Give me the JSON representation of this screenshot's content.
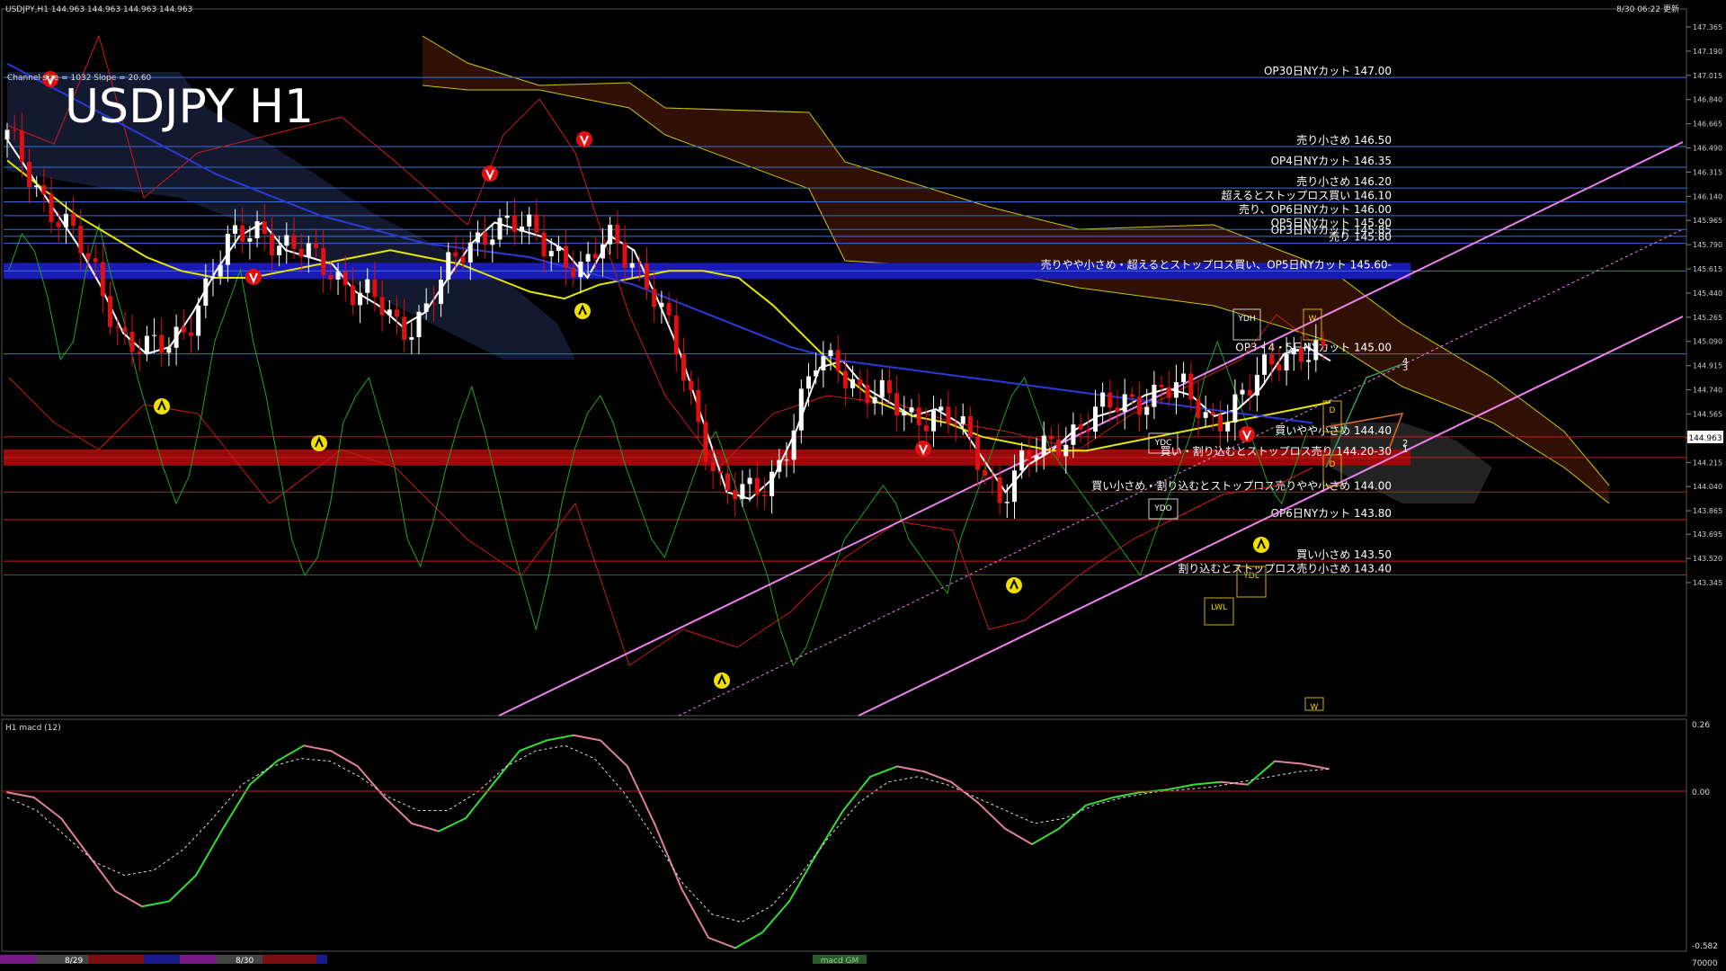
{
  "header": {
    "symbol_line": "USDJPY,H1  144.963 144.963 144.963 144.963",
    "datetime": "8/30 06:22 更新",
    "channel_info": "Channel size = 1032 Slope = 20.60",
    "big_title": "USDJPY H1"
  },
  "sub": {
    "title": "H1  macd (12)",
    "scale": [
      "0.26",
      "0.00",
      "-0.582"
    ],
    "bottom_value": "70000",
    "tab_label": "macd GM"
  },
  "dates": [
    "8/29",
    "8/30"
  ],
  "price_scale": [
    "147.365",
    "147.190",
    "147.015",
    "146.840",
    "146.665",
    "146.490",
    "146.315",
    "146.140",
    "145.965",
    "145.790",
    "145.615",
    "145.440",
    "145.265",
    "145.090",
    "144.915",
    "144.740",
    "144.565",
    "144.390",
    "144.215",
    "144.040",
    "143.865",
    "143.695",
    "143.520",
    "143.345"
  ],
  "current_price": "144.963",
  "colors": {
    "background": "#000000",
    "level_blue": "#3a6fd8",
    "level_red": "#cc1a1a",
    "blue_band": "#1a1ab4",
    "red_band": "#9b0a0a",
    "channel": "#ee82ee",
    "cloud": "#c84a1e",
    "ma_white": "#ffffff",
    "ma_yellow": "#e6e600",
    "ma_blue": "#2a3ad8",
    "bollinger": "#cc1a1a",
    "rsi_green": "#1fa51f",
    "macd_up": "#33dd33",
    "macd_down": "#e08098"
  },
  "levels": [
    {
      "price": 147.0,
      "label": "OP30日NYカット 147.00",
      "color": "blue"
    },
    {
      "price": 146.5,
      "label": "売り小さめ 146.50",
      "color": "blue"
    },
    {
      "price": 146.35,
      "label": "OP4日NYカット 146.35",
      "color": "blue"
    },
    {
      "price": 146.2,
      "label": "売り小さめ 146.20",
      "color": "blue"
    },
    {
      "price": 146.1,
      "label": "超えるとストップロス買い 146.10",
      "color": "blue"
    },
    {
      "price": 146.0,
      "label": "売り、OP6日NYカット 146.00",
      "color": "blue"
    },
    {
      "price": 145.9,
      "label": "OP5日NYカット 145.90",
      "color": "blue"
    },
    {
      "price": 145.85,
      "label": "OP3日NYカット 145.85",
      "color": "blue"
    },
    {
      "price": 145.8,
      "label": "売り 145.80",
      "color": "blue"
    },
    {
      "price": 145.6,
      "label": "売りやや小さめ・超えるとストップロス買い、OP5日NYカット 145.60-",
      "color": "blue",
      "band": true
    },
    {
      "price": 145.0,
      "label": "OP3・4・5日NYカット 145.00",
      "color": "blue"
    },
    {
      "price": 144.4,
      "label": "買いやや小さめ 144.40",
      "color": "red"
    },
    {
      "price": 144.25,
      "label": "買い・割り込むとストップロス売り 144.20-30",
      "color": "red",
      "band": true
    },
    {
      "price": 144.0,
      "label": "買い小さめ・割り込むとストップロス売りやや小さめ 144.00",
      "color": "red"
    },
    {
      "price": 143.8,
      "label": "OP6日NYカット 143.80",
      "color": "red"
    },
    {
      "price": 143.5,
      "label": "買い小さめ 143.50",
      "color": "red"
    },
    {
      "price": 143.4,
      "label": "割り込むとストップロス売り小さめ 143.40",
      "color": "red"
    }
  ],
  "markers": {
    "box_labels": [
      "YDH",
      "YDC",
      "YDO",
      "YDL",
      "LWL",
      "W",
      "W",
      "D",
      "D"
    ],
    "wave_labels": [
      "4",
      "3",
      "2",
      "1"
    ]
  },
  "chart_data": [
    {
      "type": "line",
      "title": "USDJPY H1",
      "ylim": [
        143.345,
        147.365
      ],
      "series": [
        {
          "values": [
            146.55,
            146.3,
            146.05,
            145.8,
            145.5,
            145.15,
            145.0,
            145.05,
            145.3,
            145.6,
            145.85,
            145.95,
            145.75,
            145.7,
            145.65,
            145.45,
            145.35,
            145.2,
            145.3,
            145.55,
            145.8,
            145.95,
            145.9,
            145.85,
            145.75,
            145.55,
            145.85,
            145.75,
            145.4,
            145.0,
            144.5,
            144.0,
            143.95,
            144.1,
            144.45,
            144.9,
            144.95,
            144.75,
            144.65,
            144.55,
            144.6,
            144.5,
            144.25,
            144.0,
            144.2,
            144.3,
            144.45,
            144.55,
            144.6,
            144.7,
            144.75,
            144.7,
            144.55,
            144.6,
            144.75,
            145.0,
            145.05,
            144.95
          ]
        },
        {
          "values": [
            146.4,
            146.2,
            146.0,
            145.85,
            145.7,
            145.6,
            145.55,
            145.55,
            145.6,
            145.65,
            145.7,
            145.75,
            145.7,
            145.65,
            145.55,
            145.45,
            145.4,
            145.5,
            145.55,
            145.6,
            145.6,
            145.55,
            145.35,
            145.1,
            144.85,
            144.65,
            144.55,
            144.5,
            144.4,
            144.35,
            144.3,
            144.3,
            144.35,
            144.4,
            144.45,
            144.5,
            144.55,
            144.6,
            144.65
          ]
        },
        {
          "values": [
            147.1,
            146.9,
            146.7,
            146.5,
            146.3,
            146.15,
            146.0,
            145.9,
            145.8,
            145.75,
            145.7,
            145.6,
            145.5,
            145.35,
            145.2,
            145.05,
            144.95,
            144.9,
            144.85,
            144.8,
            144.75,
            144.7,
            144.65,
            144.6,
            144.55,
            144.5
          ]
        }
      ]
    },
    {
      "type": "line",
      "title": "H1  macd (12)",
      "ylim": [
        -0.582,
        0.26
      ],
      "series": [
        {
          "values": [
            0.02,
            0.0,
            -0.08,
            -0.22,
            -0.36,
            -0.42,
            -0.4,
            -0.3,
            -0.12,
            0.05,
            0.14,
            0.2,
            0.18,
            0.12,
            0.0,
            -0.1,
            -0.13,
            -0.08,
            0.05,
            0.18,
            0.22,
            0.24,
            0.22,
            0.12,
            -0.1,
            -0.35,
            -0.54,
            -0.58,
            -0.52,
            -0.4,
            -0.22,
            -0.05,
            0.08,
            0.12,
            0.1,
            0.06,
            -0.02,
            -0.12,
            -0.18,
            -0.12,
            -0.03,
            0.0,
            0.02,
            0.03,
            0.05,
            0.06,
            0.05,
            0.14,
            0.13,
            0.11
          ]
        },
        {
          "values": [
            0.0,
            -0.05,
            -0.15,
            -0.25,
            -0.3,
            -0.28,
            -0.2,
            -0.08,
            0.05,
            0.12,
            0.15,
            0.14,
            0.08,
            0.0,
            -0.05,
            -0.05,
            0.02,
            0.12,
            0.18,
            0.2,
            0.15,
            0.02,
            -0.15,
            -0.33,
            -0.45,
            -0.48,
            -0.42,
            -0.3,
            -0.15,
            -0.02,
            0.06,
            0.08,
            0.05,
            0.0,
            -0.05,
            -0.1,
            -0.08,
            -0.03,
            0.0,
            0.02,
            0.03,
            0.04,
            0.06,
            0.08,
            0.1,
            0.11
          ]
        }
      ]
    }
  ]
}
